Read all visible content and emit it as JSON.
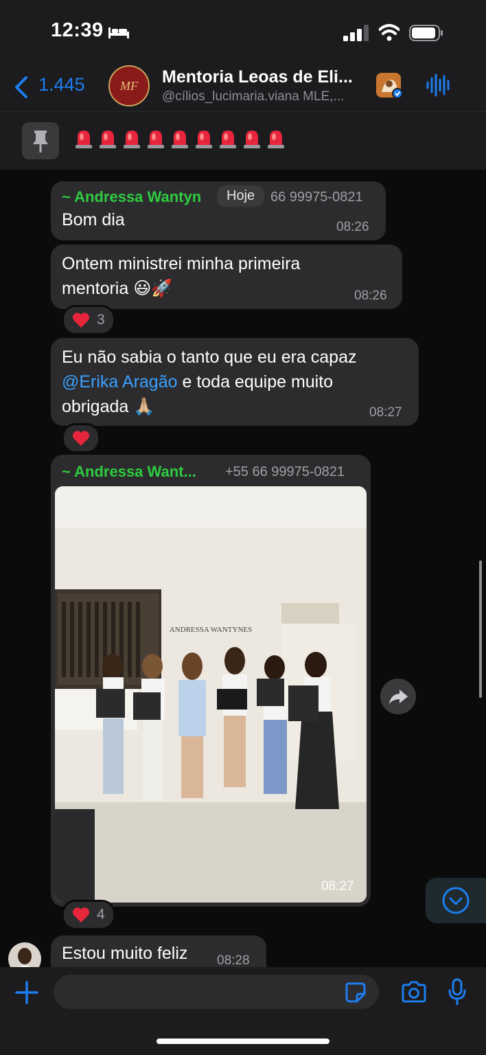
{
  "status_bar": {
    "time": "12:39"
  },
  "header": {
    "back_count": "1.445",
    "title": "Mentoria Leoas de Eli...",
    "subtitle": "@cílios_lucimaria.viana MLE,..."
  },
  "pinned": {
    "emoji_count": 9
  },
  "chat": {
    "day_label": "Hoje",
    "messages": [
      {
        "sender": "~ Andressa Wantyn",
        "phone": "66 99975-0821",
        "text": "Bom dia",
        "time": "08:26"
      },
      {
        "text_line1": "Ontem ministrei minha primeira",
        "text_line2": "mentoria 😃🚀",
        "time": "08:26",
        "reaction_count": "3"
      },
      {
        "text_line1_before": "Eu não sabia o tanto que eu era capaz",
        "mention": "@Erika Aragão",
        "text_line2_after": " e toda equipe muito",
        "text_line3": "obrigada 🙏🏼",
        "time": "08:27"
      },
      {
        "sender": "~ Andressa Want...",
        "phone": "+55 66 99975-0821",
        "photo_sign": "ANDRESSA WANTYNES",
        "time": "08:27",
        "reaction_count": "4"
      },
      {
        "text": "Estou muito feliz",
        "time": "08:28"
      }
    ]
  },
  "colors": {
    "accent_blue": "#1c7ef0",
    "sender_green": "#2ecc40",
    "bubble": "#2c2c2e",
    "background": "#0b0b0b"
  },
  "icons": [
    "bed-icon",
    "signal-icon",
    "wifi-icon",
    "battery-icon",
    "back-chevron-icon",
    "video-call-icon",
    "voice-wave-icon",
    "pin-icon",
    "siren-icon",
    "heart-icon",
    "forward-icon",
    "chevron-down-icon",
    "plus-icon",
    "sticker-icon",
    "camera-icon",
    "microphone-icon"
  ]
}
